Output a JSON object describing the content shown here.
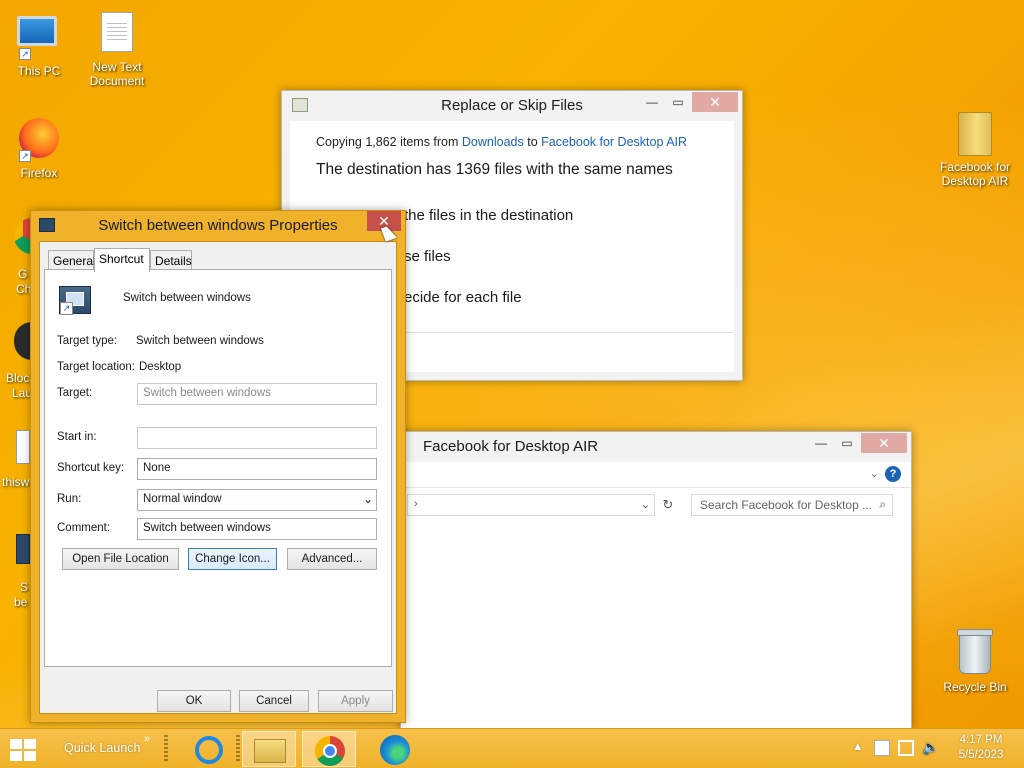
{
  "desktop": {
    "icons": [
      {
        "label": "This PC"
      },
      {
        "label": "New Text Document"
      },
      {
        "label": "Firefox"
      },
      {
        "label": "Facebook for Desktop AIR"
      },
      {
        "label": "Recycle Bin"
      }
    ],
    "partial_icons": [
      "G",
      "Ch",
      "Bloc",
      "Lau",
      "thisw",
      "S",
      "be"
    ]
  },
  "replace_dialog": {
    "title": "Replace or Skip Files",
    "copy_prefix": "Copying 1,862 items from ",
    "source": "Downloads",
    "copy_mid": " to ",
    "destination": "Facebook for Desktop AIR",
    "heading": "The destination has 1369 files with the same names",
    "option_replace": "the files in the destination",
    "option_skip": "se files",
    "option_decide": "ecide for each file"
  },
  "explorer": {
    "title": "Facebook for Desktop AIR",
    "search_placeholder": "Search Facebook for Desktop ...",
    "help_icon": "?"
  },
  "properties": {
    "title": "Switch between windows Properties",
    "tabs": [
      "General",
      "Shortcut",
      "Details"
    ],
    "active_tab": "Shortcut",
    "name": "Switch between windows",
    "target_type_label": "Target type:",
    "target_type": "Switch between windows",
    "target_location_label": "Target location:",
    "target_location": "Desktop",
    "target_label": "Target:",
    "target_value": "Switch between windows",
    "start_in_label": "Start in:",
    "start_in_value": "",
    "shortcut_key_label": "Shortcut key:",
    "shortcut_key_value": "None",
    "run_label": "Run:",
    "run_value": "Normal window",
    "comment_label": "Comment:",
    "comment_value": "Switch between windows",
    "btn_open_location": "Open File Location",
    "btn_change_icon": "Change Icon...",
    "btn_advanced": "Advanced...",
    "btn_ok": "OK",
    "btn_cancel": "Cancel",
    "btn_apply": "Apply"
  },
  "taskbar": {
    "quick_launch": "Quick Launch",
    "time": "4:17 PM",
    "date": "5/5/2023"
  },
  "colors": {
    "window_frame": "#f0b22a",
    "close_button": "#c7504a",
    "link": "#1a63b7"
  }
}
